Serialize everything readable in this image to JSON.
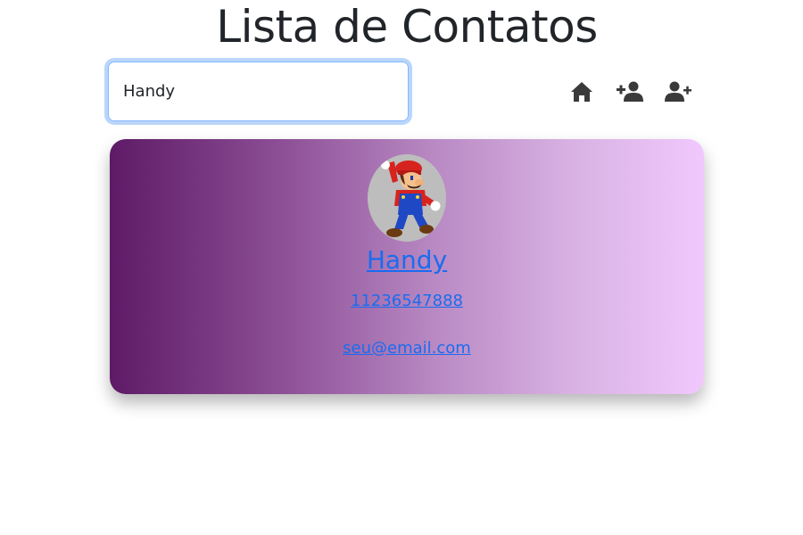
{
  "header": {
    "title": "Lista de Contatos"
  },
  "search": {
    "value": "Handy",
    "placeholder": ""
  },
  "toolbar": {
    "icons": [
      "home-icon",
      "add-contact-icon",
      "manage-contacts-icon"
    ],
    "icon_color": "#3a3a3a"
  },
  "contact_card": {
    "name": "Handy",
    "phone": "11236547888",
    "email": "seu@email.com",
    "avatar_icon": "mario-avatar",
    "gradient_start": "#5e1a66",
    "gradient_end": "#f0c8fd",
    "link_color": "#1a6cf0"
  }
}
